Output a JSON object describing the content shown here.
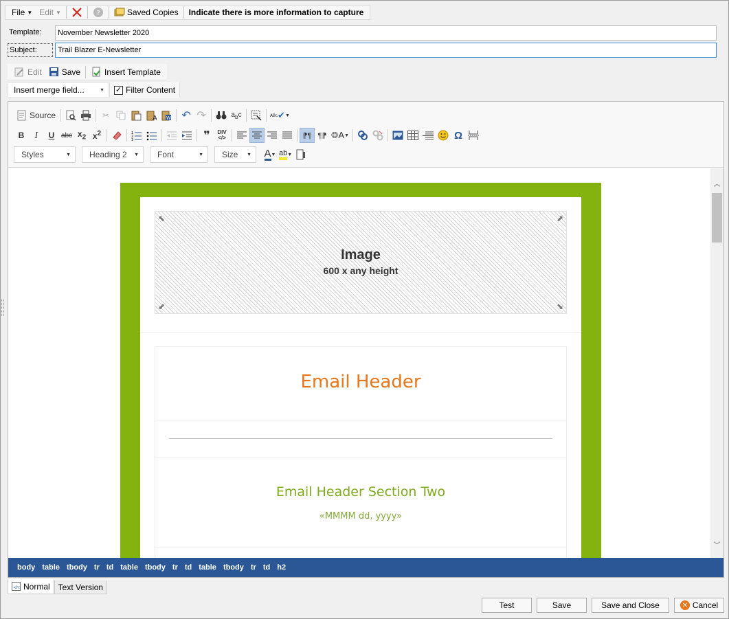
{
  "menubar": {
    "file": "File",
    "edit": "Edit",
    "saved_copies": "Saved Copies",
    "indicate": "Indicate there is more information to capture"
  },
  "form": {
    "template_label": "Template:",
    "template_value": "November Newsletter 2020",
    "subject_label": "Subject:",
    "subject_value": "Trail Blazer E-Newsletter"
  },
  "toolbar2": {
    "edit": "Edit",
    "save": "Save",
    "insert_template": "Insert Template"
  },
  "toolbar3": {
    "merge_field": "Insert merge field...",
    "filter_content": "Filter Content",
    "filter_checked": true
  },
  "editor_toolbar": {
    "source": "Source",
    "styles": "Styles",
    "format": "Heading 2",
    "font": "Font",
    "size": "Size"
  },
  "email": {
    "image_title": "Image",
    "image_size": "600 x any height",
    "header": "Email Header",
    "section_two": "Email Header Section Two",
    "date_token": "«MMMM dd, yyyy»",
    "colors": {
      "frame": "#84b20f",
      "header": "#e8761a",
      "section": "#7fab1d"
    }
  },
  "path": [
    "body",
    "table",
    "tbody",
    "tr",
    "td",
    "table",
    "tbody",
    "tr",
    "td",
    "table",
    "tbody",
    "tr",
    "td",
    "h2"
  ],
  "tabs": {
    "normal": "Normal",
    "text_version": "Text Version"
  },
  "buttons": {
    "test": "Test",
    "save": "Save",
    "save_close": "Save and Close",
    "cancel": "Cancel"
  }
}
